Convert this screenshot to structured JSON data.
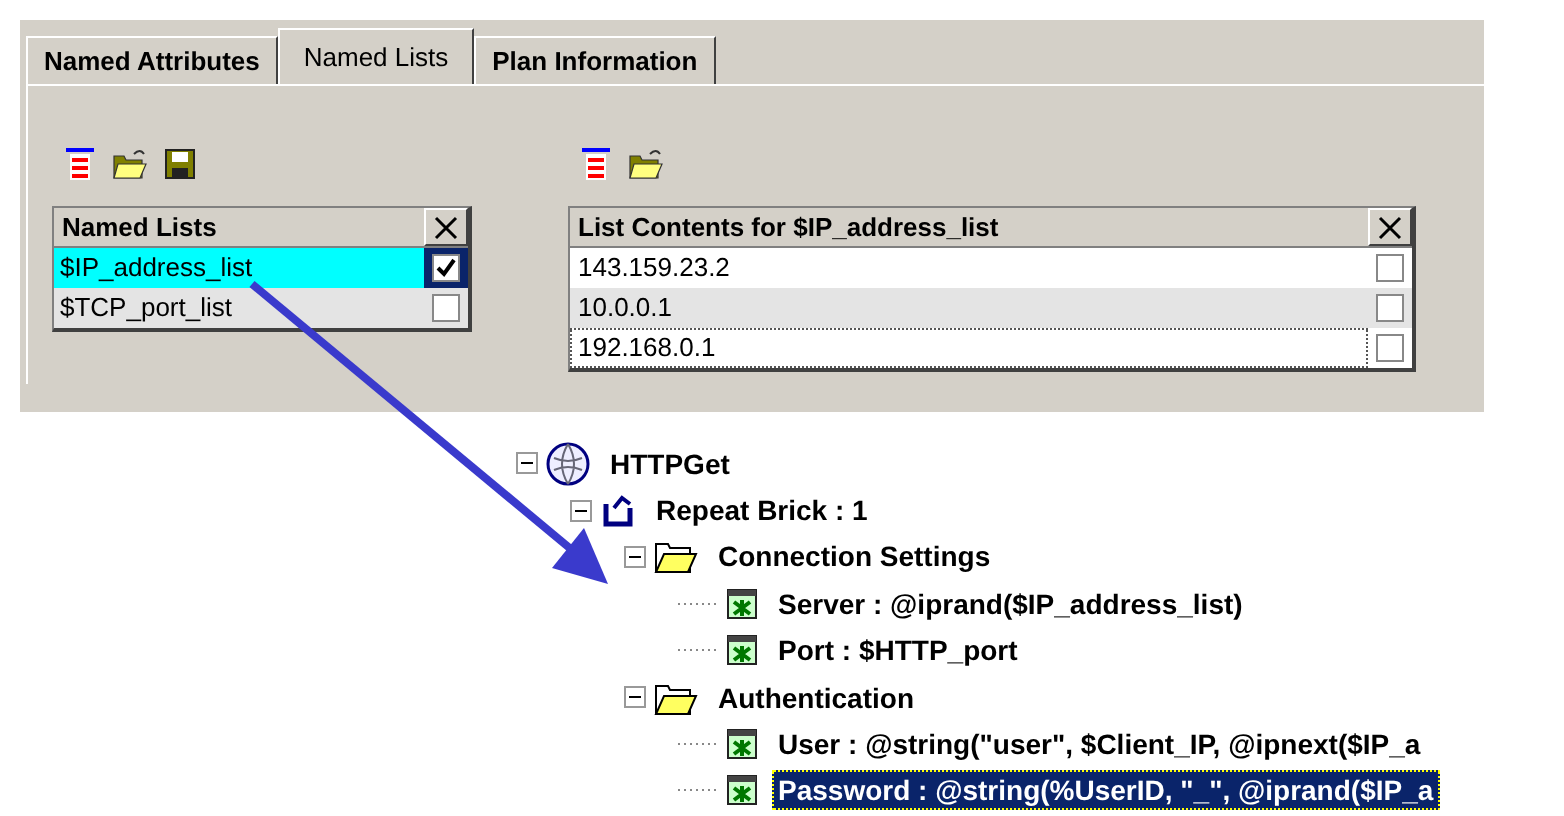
{
  "tabs": [
    {
      "label": "Named Attributes",
      "selected": false
    },
    {
      "label": "Named Lists",
      "selected": true
    },
    {
      "label": "Plan Information",
      "selected": false
    }
  ],
  "named_lists": {
    "header": "Named Lists",
    "rows": [
      {
        "name": "$IP_address_list",
        "selected": true,
        "checked": true
      },
      {
        "name": "$TCP_port_list",
        "selected": false,
        "checked": false
      }
    ]
  },
  "list_contents": {
    "header": "List Contents for $IP_address_list",
    "rows": [
      {
        "value": "143.159.23.2",
        "focused": false,
        "checked": false
      },
      {
        "value": "10.0.0.1",
        "focused": false,
        "checked": false
      },
      {
        "value": "192.168.0.1",
        "focused": true,
        "checked": false
      }
    ]
  },
  "tree": [
    {
      "label": "HTTPGet",
      "kind": "globe",
      "expanded": true,
      "selected": false,
      "children": [
        {
          "label": "Repeat Brick : 1",
          "kind": "repeat",
          "expanded": true,
          "selected": false,
          "children": [
            {
              "label": "Connection Settings",
              "kind": "folder",
              "expanded": true,
              "selected": false,
              "children": [
                {
                  "label": "Server : @iprand($IP_address_list)",
                  "kind": "item",
                  "selected": false
                },
                {
                  "label": "Port : $HTTP_port",
                  "kind": "item",
                  "selected": false
                }
              ]
            },
            {
              "label": "Authentication",
              "kind": "folder",
              "expanded": true,
              "selected": false,
              "children": [
                {
                  "label": "User : @string(\"user\", $Client_IP, @ipnext($IP_a",
                  "kind": "item",
                  "selected": false
                },
                {
                  "label": "Password : @string(%UserID, \"_\", @iprand($IP_a",
                  "kind": "item",
                  "selected": true
                }
              ]
            }
          ]
        }
      ]
    }
  ]
}
